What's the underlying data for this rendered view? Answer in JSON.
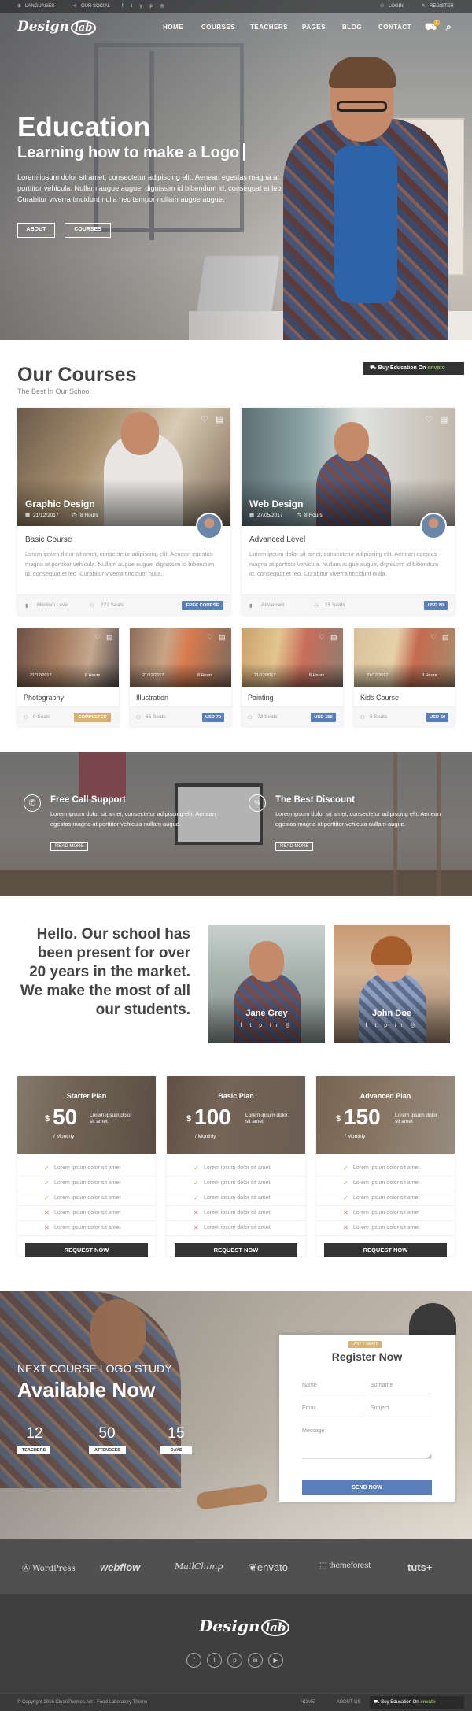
{
  "topbar": {
    "languages": "LANGUAGES",
    "social": "OUR SOCIAL",
    "login": "LOGIN",
    "register": "REGISTER"
  },
  "nav": {
    "logo_text": "Design",
    "logo_badge": "lab",
    "items": [
      "HOME",
      "COURSES",
      "TEACHERS",
      "PAGES",
      "BLOG",
      "CONTACT"
    ],
    "cart_count": "2"
  },
  "hero": {
    "title": "Education",
    "subtitle": "Learning how to make a Logo",
    "text": "Lorem ipsum dolor sit amet, consectetur adipiscing elit. Aenean egestas magna at porttitor vehicula. Nullam augue augue, dignissim id bibendum id, consequat et leo. Curabitur viverra tincidunt nulla nec tempor nullam augue augue.",
    "btn_about": "ABOUT",
    "btn_courses": "COURSES"
  },
  "courses": {
    "title": "Our Courses",
    "subtitle": "The Best In Our School",
    "envato_prefix": "Buy Education On",
    "envato_brand": "envato",
    "big": [
      {
        "title": "Graphic Design",
        "date": "21/12/2017",
        "hours": "8 Hours",
        "sub": "Basic Course",
        "desc": "Lorem ipsum dolor sit amet, consectetur adipiscing elit. Aenean egestas magna at porttitor vehicula. Nullam augue augue, dignissim id bibendum id, consequat et leo. Curabitur viverra tincidunt nulla.",
        "level": "Medium Level",
        "seats": "221 Seats",
        "badge": "FREE COURSE"
      },
      {
        "title": "Web Design",
        "date": "27/05/2017",
        "hours": "8 Hours",
        "sub": "Advanced Level",
        "desc": "Lorem ipsum dolor sit amet, consectetur adipiscing elit. Aenean egestas magna at porttitor vehicula. Nullam augue augue, dignissim id bibendum id, consequat et leo. Curabitur viverra tincidunt nulla.",
        "level": "Advanced",
        "seats": "15 Seats",
        "badge": "USD 80"
      }
    ],
    "small": [
      {
        "title": "Photography",
        "date": "21/12/2017",
        "hours": "8 Hours",
        "seats": "0 Seats",
        "badge": "COMPLETED"
      },
      {
        "title": "Illustration",
        "date": "21/12/2017",
        "hours": "8 Hours",
        "seats": "65 Seats",
        "badge": "USD 70"
      },
      {
        "title": "Painting",
        "date": "21/12/2017",
        "hours": "8 Hours",
        "seats": "73 Seats",
        "badge": "USD 150"
      },
      {
        "title": "Kids Course",
        "date": "21/12/2017",
        "hours": "8 Hours",
        "seats": "6 Seats",
        "badge": "USD 50"
      }
    ]
  },
  "features": [
    {
      "title": "Free Call Support",
      "text": "Lorem ipsum dolor sit amet, consectetur adipiscing elit. Aenean egestas magna at porttitor vehicula nullam augue.",
      "btn": "READ MORE"
    },
    {
      "title": "The Best Discount",
      "text": "Lorem ipsum dolor sit amet, consectetur adipiscing elit. Aenean egestas magna at porttitor vehicula nullam augue.",
      "btn": "READ MORE"
    }
  ],
  "about": {
    "text": "Hello. Our school has been present for over 20 years in the market. We make the most of all our students.",
    "teachers": [
      {
        "name": "Jane Grey"
      },
      {
        "name": "John Doe"
      }
    ]
  },
  "pricing": {
    "plans": [
      {
        "name": "Starter Plan",
        "currency": "$",
        "price": "50",
        "desc": "Lorem ipsum dolor sit amet",
        "period": "/ Monthly"
      },
      {
        "name": "Basic Plan",
        "currency": "$",
        "price": "100",
        "desc": "Lorem ipsum dolor sit amet",
        "period": "/ Monthly"
      },
      {
        "name": "Advanced Plan",
        "currency": "$",
        "price": "150",
        "desc": "Lorem ipsum dolor sit amet",
        "period": "/ Monthly"
      }
    ],
    "feature_text": "Lorem ipsum dolor sit amet",
    "btn": "REQUEST NOW"
  },
  "register": {
    "pre_title": "NEXT COURSE LOGO STUDY",
    "title": "Available Now",
    "counters": [
      {
        "num": "12",
        "label": "TEACHERS"
      },
      {
        "num": "50",
        "label": "ATTENDEES"
      },
      {
        "num": "15",
        "label": "DAYS"
      }
    ],
    "form": {
      "tag": "LAST 7 SEATS",
      "title": "Register Now",
      "name": "Name",
      "surname": "Surname",
      "email": "Email",
      "subject": "Subject",
      "message": "Message",
      "send": "SEND NOW"
    }
  },
  "partners": [
    "WordPress",
    "webflow",
    "MailChimp",
    "envato",
    "themeforest",
    "tuts+"
  ],
  "footer": {
    "logo_text": "Design",
    "logo_badge": "lab",
    "copyright": "© Copyright 2016 CleanThemes.net - Food Laboratory Theme",
    "links": [
      "HOME",
      "ABOUT US"
    ],
    "envato_prefix": "Buy Education On",
    "envato_brand": "envato"
  }
}
